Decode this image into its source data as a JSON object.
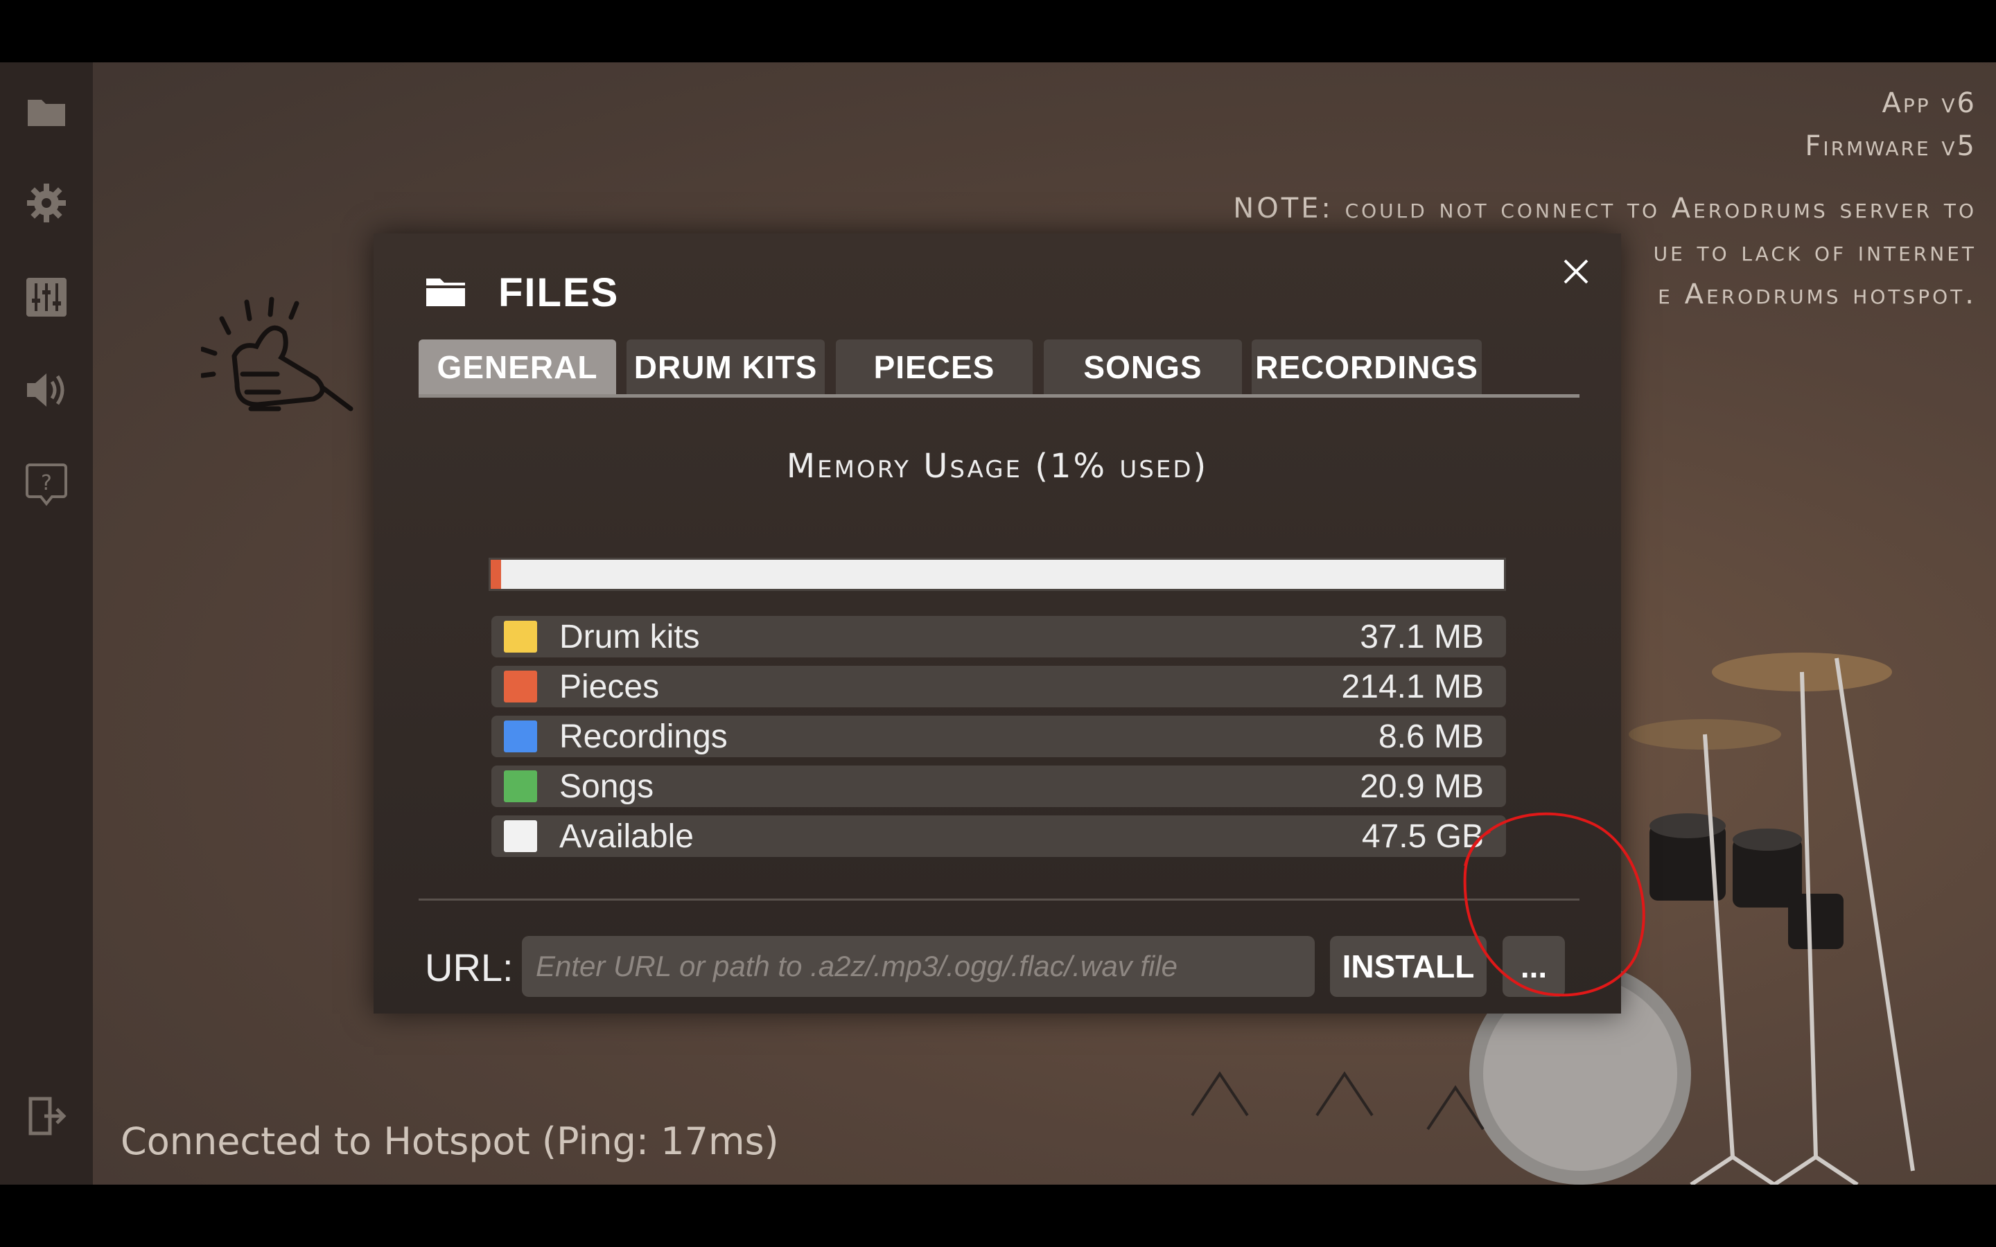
{
  "versions": {
    "app": "App v6",
    "firmware": "Firmware v5"
  },
  "note": "NOTE: could not connect to Aerodrums server to ... due to lack of internet ... the Aerodrums hotspot.",
  "note_lines": [
    "NOTE: could not connect to Aerodrums server to",
    "ue to lack of internet",
    "e Aerodrums hotspot."
  ],
  "status": "Connected to Hotspot  (Ping: 17ms)",
  "sidebar": {
    "items": [
      {
        "icon": "folder-icon"
      },
      {
        "icon": "gear-icon"
      },
      {
        "icon": "mixer-icon"
      },
      {
        "icon": "speaker-icon"
      },
      {
        "icon": "help-icon"
      },
      {
        "icon": "exit-icon"
      }
    ]
  },
  "modal": {
    "title": "FILES",
    "tabs": [
      {
        "label": "GENERAL",
        "active": true
      },
      {
        "label": "DRUM KITS",
        "active": false
      },
      {
        "label": "PIECES",
        "active": false
      },
      {
        "label": "SONGS",
        "active": false
      },
      {
        "label": "RECORDINGS",
        "active": false
      }
    ],
    "memory": {
      "title": "Memory Usage  (1% used)",
      "used_fraction": 0.01,
      "rows": [
        {
          "label": "Drum kits",
          "value": "37.1 MB",
          "color": "#f5cc4a"
        },
        {
          "label": "Pieces",
          "value": "214.1 MB",
          "color": "#e5633e"
        },
        {
          "label": "Recordings",
          "value": "8.6 MB",
          "color": "#4a8ef0"
        },
        {
          "label": "Songs",
          "value": "20.9 MB",
          "color": "#5bb55a"
        },
        {
          "label": "Available",
          "value": "47.5 GB",
          "color": "#f2f2f2"
        }
      ]
    },
    "url": {
      "label": "URL:",
      "placeholder": "Enter URL or path to .a2z/.mp3/.ogg/.flac/.wav file",
      "value": ""
    },
    "install_label": "INSTALL",
    "browse_label": "..."
  },
  "colors": {
    "annotation": "#e01818",
    "memory_fill": "#e05f3c"
  }
}
